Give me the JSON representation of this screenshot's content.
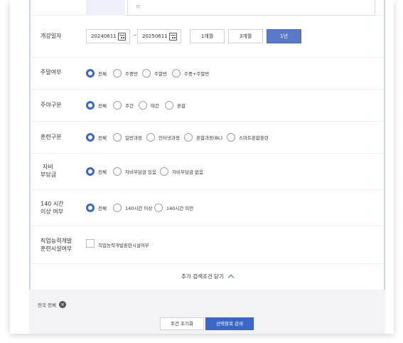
{
  "top": {
    "input_text": "ㅁ"
  },
  "date_row": {
    "label": "개강일자",
    "start": "20240611",
    "separator": "~",
    "end": "20250611",
    "periods": [
      "1개월",
      "3개월",
      "1년"
    ],
    "active_period": "1년"
  },
  "weekday_row": {
    "label": "주말여부",
    "options": [
      "전체",
      "주중반",
      "주말반",
      "주중+주말반"
    ],
    "selected": "전체"
  },
  "daynight_row": {
    "label": "주야구분",
    "options": [
      "전체",
      "주간",
      "야간",
      "혼합"
    ],
    "selected": "전체"
  },
  "training_row": {
    "label": "훈련구분",
    "options": [
      "전체",
      "일반과정",
      "인터넷과정",
      "혼합과정(BL)",
      "스마트혼합훈련"
    ],
    "selected": "전체"
  },
  "cost_row": {
    "label_line1": "자비",
    "label_line2": "부담금",
    "options": [
      "전체",
      "자비부담금 있음",
      "자비부담금 없음"
    ],
    "selected": "전체"
  },
  "hours_row": {
    "label_line1": "140 시간",
    "label_line2": "이상 여부",
    "options": [
      "전체",
      "140시간 이상",
      "140시간 미만"
    ],
    "selected": "전체"
  },
  "facility_row": {
    "label_line1": "직업능력개발",
    "label_line2": "훈련시설여부",
    "checkbox_label": "직업능력개발훈련시설여부",
    "checked": false
  },
  "toggle": {
    "label": "추가 검색조건 닫기"
  },
  "bottom": {
    "chip_label": "전국 전체",
    "reset_label": "조건 초기화",
    "search_label": "선택항목 검색"
  },
  "colors": {
    "accent": "#3a66c8",
    "active_period_bg": "#5b79c9",
    "border": "#c9d4ef"
  },
  "icons": [
    "calendar-icon",
    "chevron-up-icon",
    "close-circle-icon"
  ]
}
